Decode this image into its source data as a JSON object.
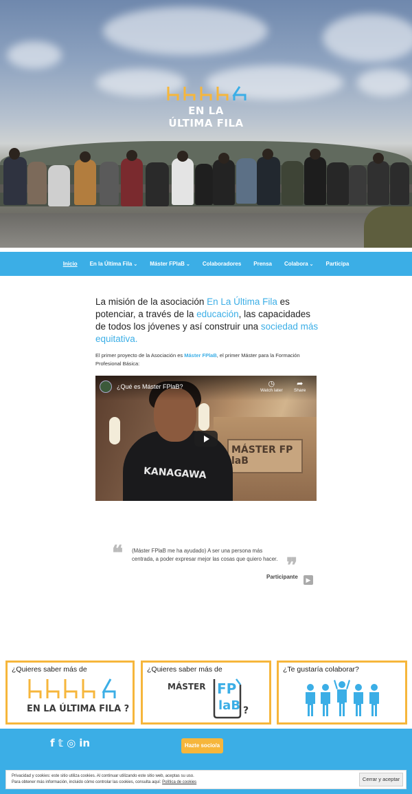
{
  "hero": {
    "logo_text": "EN LA ÚLTIMA FILA",
    "colors": {
      "chairs": "#f6b63b",
      "accent_chair": "#3baee6"
    }
  },
  "nav": {
    "items": [
      {
        "label": "Inicio",
        "active": true,
        "dropdown": false
      },
      {
        "label": "En la Última Fila",
        "active": false,
        "dropdown": true
      },
      {
        "label": "Máster FPlaB",
        "active": false,
        "dropdown": true
      },
      {
        "label": "Colaboradores",
        "active": false,
        "dropdown": false
      },
      {
        "label": "Prensa",
        "active": false,
        "dropdown": false
      },
      {
        "label": "Colabora",
        "active": false,
        "dropdown": true
      },
      {
        "label": "Participa",
        "active": false,
        "dropdown": false
      }
    ],
    "background": "#3baee6"
  },
  "mission": {
    "p1": "La misión de la asociación ",
    "h1": "En La Última Fila",
    "p2": " es potenciar, a través de la ",
    "h2": "educación",
    "p3": ", las capacidades de todos los jóvenes y así construir una ",
    "h3": "sociedad más equitativa."
  },
  "project": {
    "p1": "El primer proyecto de la Asociación es ",
    "link": "Máster FPlaB",
    "p2": ", el primer Máster para la Formación Profesional Básica:"
  },
  "video": {
    "title": "¿Qué es Máster FPlaB?",
    "watch_later": "Watch later",
    "share": "Share",
    "sign_text": "MÁSTER FP laB",
    "shirt_text": "KANAGAWA"
  },
  "testimonial": {
    "quote": "(Máster FPlaB me ha ayudado) A ser una persona más centrada, a poder expresar mejor las cosas que quiero hacer.",
    "author": "Participante",
    "open_mark": "❝",
    "close_mark": "❞"
  },
  "cards": [
    {
      "title": "¿Quieres saber más de",
      "logo_text": "EN LA ÚLTIMA FILA ?"
    },
    {
      "title": "¿Quieres saber más de",
      "logo_a": "MÁSTER",
      "logo_b": "FP",
      "logo_c": "laB",
      "logo_q": "?"
    },
    {
      "title": "¿Te gustaría colaborar?"
    }
  ],
  "footer": {
    "social": [
      "f",
      "𝕥",
      "◎",
      "in"
    ],
    "member_button": "Hazte socio/a",
    "background": "#3baee6",
    "button_color": "#f6b63b"
  },
  "cookies": {
    "line1": "Privacidad y cookies: este sitio utiliza cookies. Al continuar utilizando este sitio web, aceptas su uso.",
    "line2": "Para obtener más información, incluido cómo controlar las cookies, consulta aquí: ",
    "link": "Política de cookies",
    "button": "Cerrar y aceptar"
  }
}
